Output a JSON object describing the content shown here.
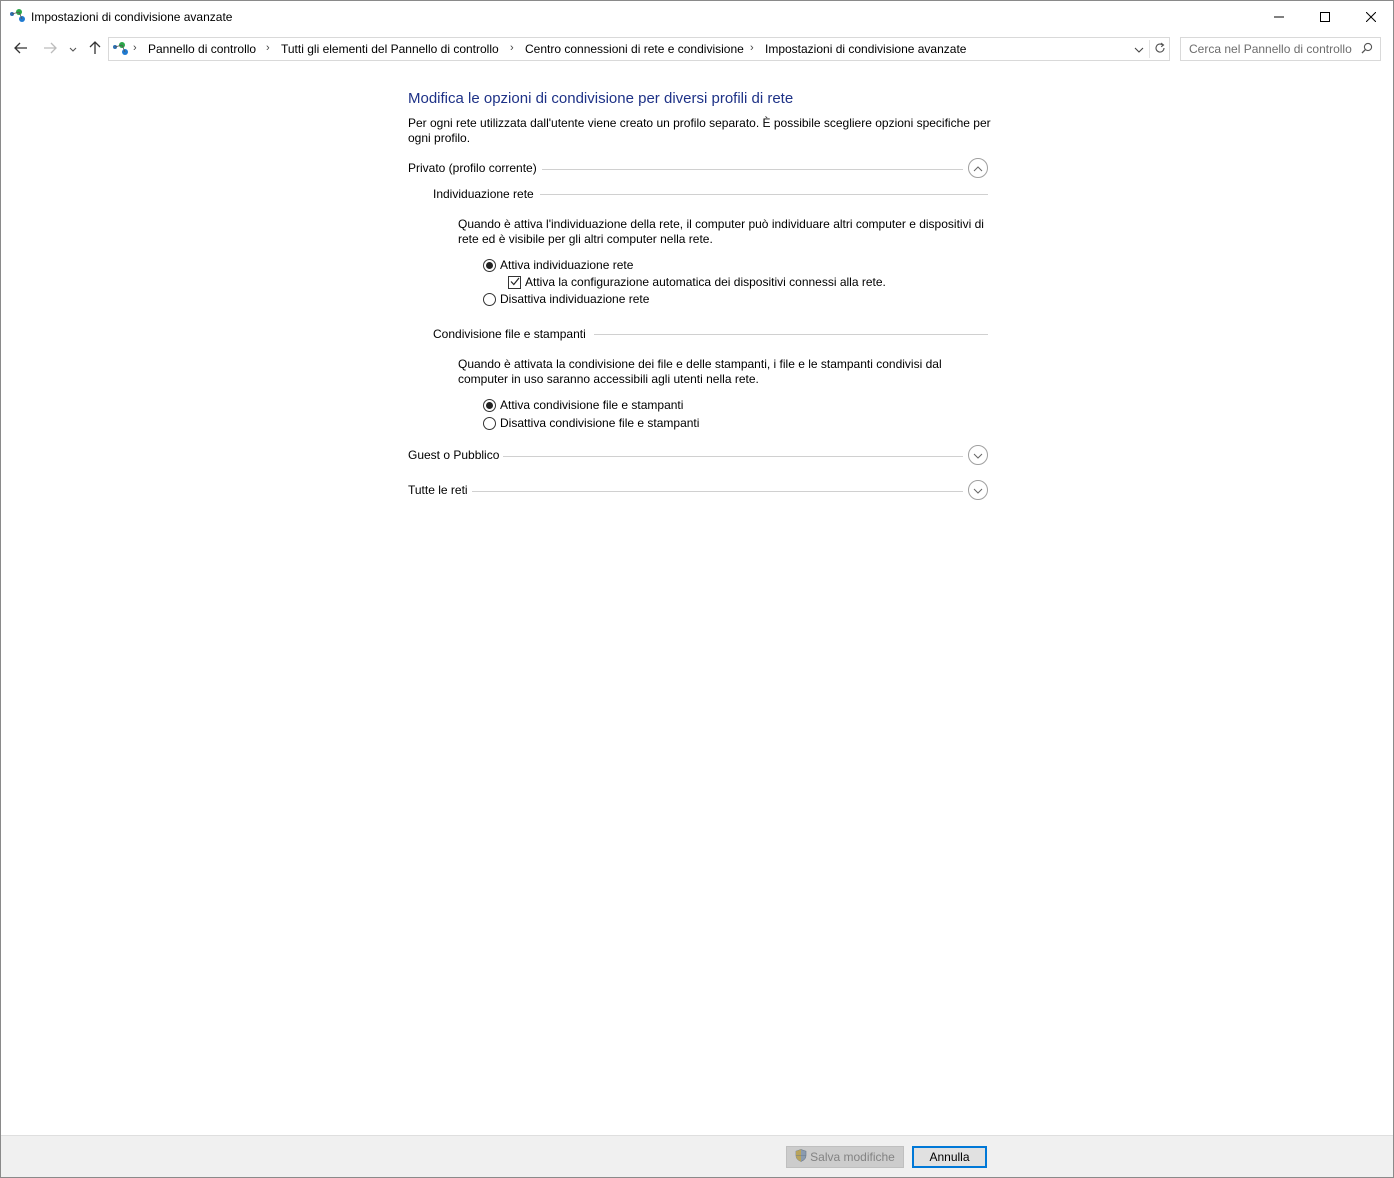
{
  "window": {
    "title": "Impostazioni di condivisione avanzate",
    "controls": {
      "minimize_icon": "minimize-icon",
      "maximize_icon": "maximize-icon",
      "close_icon": "close-icon"
    }
  },
  "nav": {
    "back_icon": "arrow-left-icon",
    "forward_icon": "arrow-right-icon",
    "recent_icon": "chevron-down-icon",
    "up_icon": "arrow-up-icon"
  },
  "address": {
    "icon": "network-center-icon",
    "breadcrumbs": [
      "Pannello di controllo",
      "Tutti gli elementi del Pannello di controllo",
      "Centro connessioni di rete e condivisione",
      "Impostazioni di condivisione avanzate"
    ],
    "separator": "›"
  },
  "search": {
    "placeholder": "Cerca nel Pannello di controllo"
  },
  "page": {
    "title": "Modifica le opzioni di condivisione per diversi profili di rete",
    "intro": "Per ogni rete utilizzata dall'utente viene creato un profilo separato. È possibile scegliere opzioni specifiche per ogni profilo."
  },
  "profiles": {
    "private": {
      "label": "Privato (profilo corrente)",
      "expanded": true,
      "network_discovery": {
        "heading": "Individuazione rete",
        "description": "Quando è attiva l'individuazione della rete, il computer può individuare altri computer e dispositivi di rete ed è visibile per gli altri computer nella rete.",
        "option_on": "Attiva individuazione rete",
        "auto_config": "Attiva la configurazione automatica dei dispositivi connessi alla rete.",
        "auto_config_checked": true,
        "option_off": "Disattiva individuazione rete",
        "selected": "on"
      },
      "file_sharing": {
        "heading": "Condivisione file e stampanti",
        "description": "Quando è attivata la condivisione dei file e delle stampanti, i file e le stampanti condivisi dal computer in uso saranno accessibili agli utenti nella rete.",
        "option_on": "Attiva condivisione file e stampanti",
        "option_off": "Disattiva condivisione file e stampanti",
        "selected": "on"
      }
    },
    "guest": {
      "label": "Guest o Pubblico",
      "expanded": false
    },
    "all": {
      "label": "Tutte le reti",
      "expanded": false
    }
  },
  "footer": {
    "save_label": "Salva modifiche",
    "save_enabled": false,
    "cancel_label": "Annulla"
  },
  "colors": {
    "title_blue": "#1e3287",
    "focus_blue": "#0078d7",
    "footer_bg": "#f0f0f0"
  }
}
